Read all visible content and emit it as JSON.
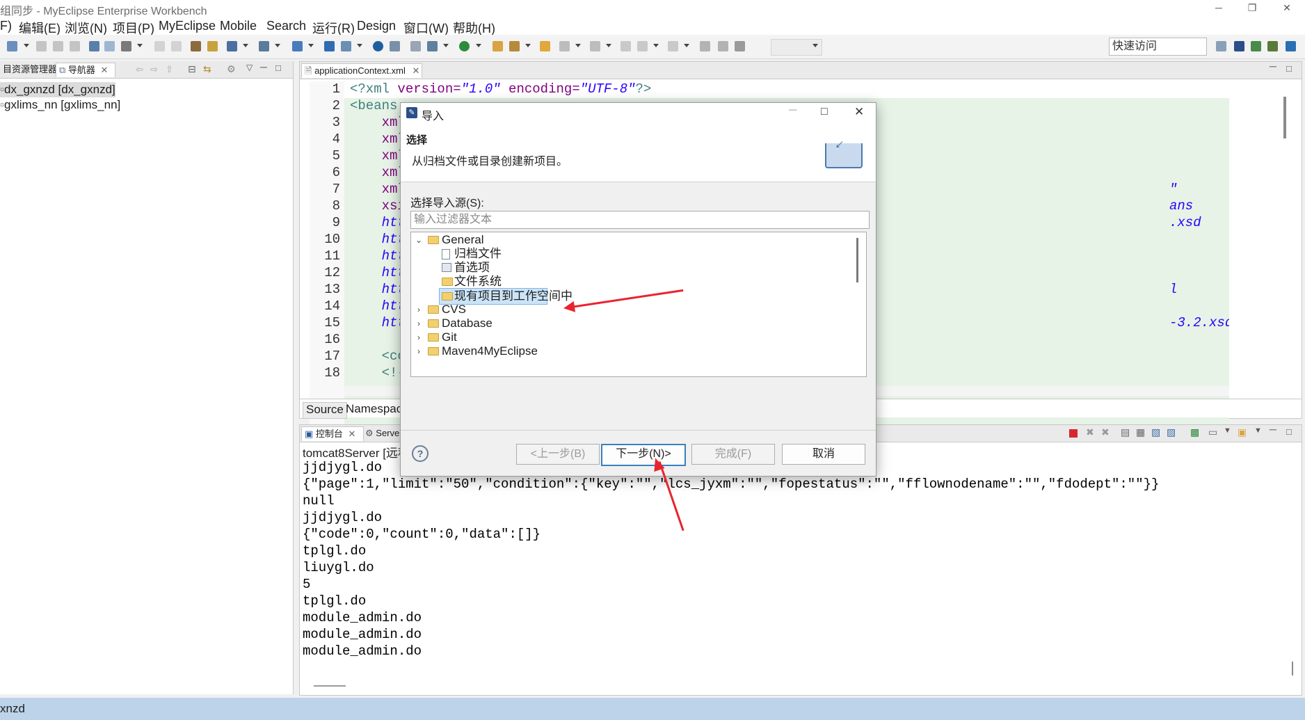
{
  "window": {
    "title": "组同步 - MyEclipse Enterprise Workbench",
    "title_visible": "组同步 - MyEclipse Enterprise Workbench",
    "minimize": "─",
    "maximize": "❐",
    "close": "✕"
  },
  "menu": [
    "F)",
    "编辑(E)",
    "浏览(N)",
    "项目(P)",
    "MyEclipse",
    "Mobile",
    "Search",
    "运行(R)",
    "Design",
    "窗口(W)",
    "帮助(H)"
  ],
  "toolbar": {
    "quick_access": "快速访问"
  },
  "left_panel": {
    "tabs": [
      "目资源管理器",
      "导航器"
    ],
    "items": [
      "dx_gxnzd [dx_gxnzd]",
      "gxlims_nn [gxlims_nn]"
    ]
  },
  "editor": {
    "tab": "applicationContext.xml",
    "line_numbers": [
      "1",
      "2",
      "3",
      "4",
      "5",
      "6",
      "7",
      "8",
      "9",
      "10",
      "11",
      "12",
      "13",
      "14",
      "15",
      "16",
      "17",
      "18"
    ],
    "lines": [
      {
        "a": "<?xml ",
        "b": "version=",
        "c": "\"1.0\"",
        "d": " encoding=",
        "e": "\"UTF-8\"",
        "f": "?>"
      },
      {
        "a": "<beans"
      },
      {
        "a": "    xml"
      },
      {
        "a": "    xml"
      },
      {
        "a": "    xml"
      },
      {
        "a": "    xml"
      },
      {
        "a": "    xml",
        "tail": "\""
      },
      {
        "a": "    xsi",
        "tail": "ans"
      },
      {
        "a": "    htt",
        "tail": ".xsd"
      },
      {
        "a": "    htt"
      },
      {
        "a": "    htt"
      },
      {
        "a": "    htt"
      },
      {
        "a": "    htt",
        "tail": "l"
      },
      {
        "a": "    htt"
      },
      {
        "a": "    htt",
        "tail": "-3.2.xsd\">"
      },
      {
        "a": ""
      },
      {
        "a": "    <co"
      },
      {
        "a": "    <!-"
      }
    ],
    "bottom_tabs": [
      "Source",
      "Namespac"
    ]
  },
  "console": {
    "tabs": [
      "控制台",
      "Server"
    ],
    "header": "tomcat8Server [远程",
    "lines": [
      "jjdjygl.do",
      "{\"page\":1,\"limit\":\"50\",\"condition\":{\"key\":\"\",\"lcs_jyxm\":\"\",\"fopestatus\":\"\",\"fflownodename\":\"\",\"fdodept\":\"\"}}",
      "null",
      "jjdjygl.do",
      "{\"code\":0,\"count\":0,\"data\":[]}",
      "tplgl.do",
      "liuygl.do",
      "5",
      "tplgl.do",
      "module_admin.do",
      "module_admin.do",
      "module_admin.do"
    ]
  },
  "status": {
    "text": "xnzd"
  },
  "dialog": {
    "title": "导入",
    "heading": "选择",
    "description": "从归档文件或目录创建新项目。",
    "source_label": "选择导入源(S):",
    "filter_placeholder": "输入过滤器文本",
    "tree": [
      {
        "label": "General",
        "expanded": true,
        "level": 0
      },
      {
        "label": "归档文件",
        "level": 1
      },
      {
        "label": "首选项",
        "level": 1
      },
      {
        "label": "文件系统",
        "level": 1
      },
      {
        "label": "现有项目到工作空间中",
        "level": 1,
        "selected": true
      },
      {
        "label": "CVS",
        "level": 0
      },
      {
        "label": "Database",
        "level": 0
      },
      {
        "label": "Git",
        "level": 0
      },
      {
        "label": "Maven4MyEclipse",
        "level": 0
      }
    ],
    "buttons": {
      "help": "?",
      "back": "<上一步(B)",
      "next": "下一步(N)>",
      "finish": "完成(F)",
      "cancel": "取消"
    }
  },
  "colors": {
    "selection": "#cce4f7",
    "arrow": "#e8242f",
    "status_bar": "#bcd3ea"
  }
}
